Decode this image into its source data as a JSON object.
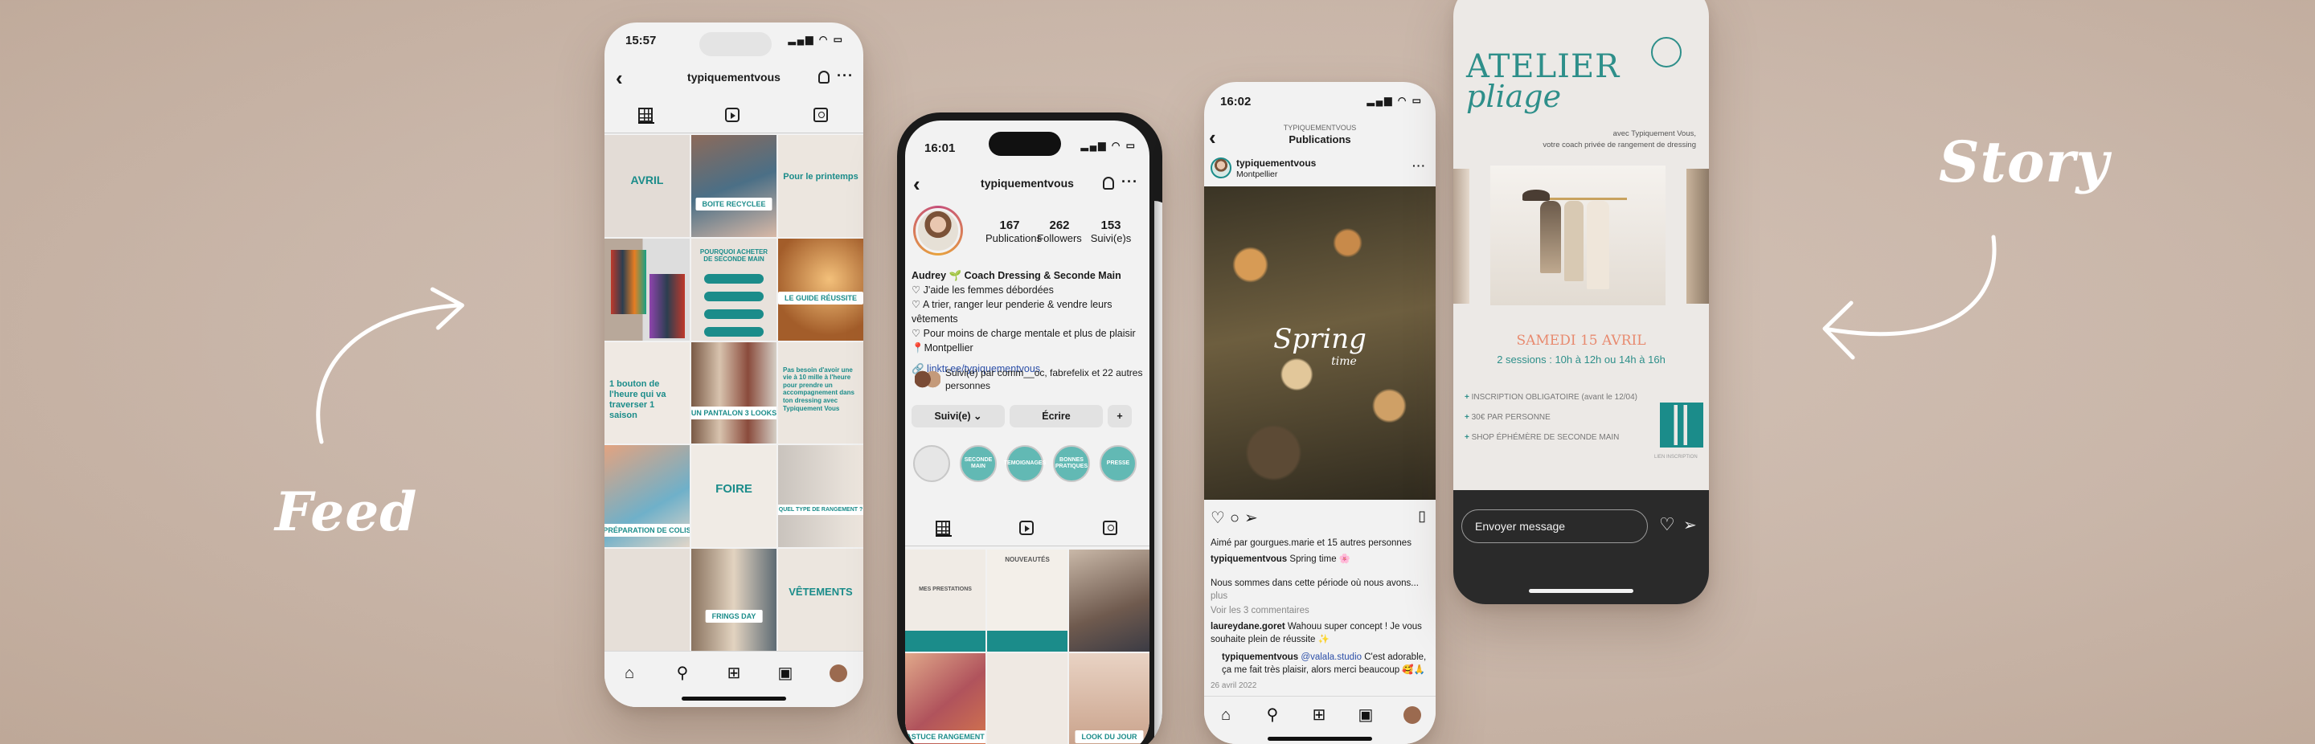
{
  "labels": {
    "feed": "Feed",
    "story": "Story"
  },
  "feed_phone": {
    "time": "15:57",
    "username": "typiquementvous",
    "tiles": [
      {
        "text": "AVRIL",
        "chip": ""
      },
      {
        "text": "",
        "chip": "BOITE RECYCLEE"
      },
      {
        "text": "Pour le printemps",
        "chip": ""
      },
      {
        "text": "",
        "chip": ""
      },
      {
        "text": "POURQUOI ACHETER DE SECONDE MAIN",
        "chip": ""
      },
      {
        "text": "",
        "chip": "LE GUIDE RÉUSSITE"
      },
      {
        "text": "1 bouton de l'heure qui va traverser 1 saison",
        "chip": ""
      },
      {
        "text": "",
        "chip": "UN PANTALON 3 LOOKS"
      },
      {
        "text": "Pas besoin d'avoir une vie à 10 mille à l'heure pour prendre un accompagnement dans ton dressing avec Typiquement Vous",
        "chip": ""
      },
      {
        "text": "",
        "chip": "PRÉPARATION DE COLIS"
      },
      {
        "text": "FOIRE",
        "chip": ""
      },
      {
        "text": "",
        "chip": "QUEL TYPE DE RANGEMENT ?"
      },
      {
        "text": "",
        "chip": ""
      },
      {
        "text": "",
        "chip": "FRINGS DAY"
      },
      {
        "text": "VÊTEMENTS",
        "chip": ""
      }
    ]
  },
  "profile_phone": {
    "time": "16:01",
    "username": "typiquementvous",
    "stats": [
      {
        "value": "167",
        "label": "Publications"
      },
      {
        "value": "262",
        "label": "Followers"
      },
      {
        "value": "153",
        "label": "Suivi(e)s"
      }
    ],
    "bio_name": "Audrey 🌱 Coach Dressing & Seconde Main",
    "bio_lines": [
      "♡ J'aide les femmes débordées",
      "♡ A trier, ranger leur penderie & vendre leurs vêtements",
      "♡ Pour moins de charge mentale et plus de plaisir",
      "📍Montpellier"
    ],
    "link": "🔗 linktr.ee/typiquementvous",
    "followed_by": "Suivi(e) par comm__oc, fabrefelix et 22 autres personnes",
    "buttons": {
      "following": "Suivi(e) ⌄",
      "message": "Écrire",
      "add": "+"
    },
    "highlights": [
      "",
      "SECONDE MAIN",
      "TEMOIGNAGES",
      "BONNES PRATIQUES",
      "PRESSE"
    ],
    "post_labels": [
      "MES PRESTATIONS",
      "NOUVEAUTÉS",
      "ASTUCE RANGEMENT",
      "LOOK DU JOUR"
    ]
  },
  "post_phone": {
    "time": "16:02",
    "header_sub": "TYPIQUEMENTVOUS",
    "header_title": "Publications",
    "username": "typiquementvous",
    "location": "Montpellier",
    "image_text": "Spring",
    "image_subtext": "time",
    "liked_by": "Aimé par gourgues.marie et 15 autres personnes",
    "caption_user": "typiquementvous",
    "caption": "Spring time 🌸",
    "caption_2": "Nous sommes dans cette période où nous avons...",
    "caption_more": "plus",
    "view_comments": "Voir les 3 commentaires",
    "comment1_user": "laureydane.goret",
    "comment1": "Wahouu super concept ! Je vous souhaite plein de réussite ✨",
    "comment2_user": "typiquementvous",
    "comment2_mention": "@valala.studio",
    "comment2": "C'est adorable, ça me fait très plaisir, alors merci beaucoup 🥰🙏",
    "date": "26 avril 2022"
  },
  "story_phone": {
    "title_line1": "ATELIER",
    "title_line2": "pliage",
    "byline1": "avec Typiquement Vous,",
    "byline2": "votre coach privée de rangement de dressing",
    "date": "SAMEDI 15 AVRIL",
    "sessions": "2 sessions : 10h à 12h ou 14h à 16h",
    "items": [
      "INSCRIPTION OBLIGATOIRE (avant le 12/04)",
      "30€ PAR PERSONNE",
      "SHOP ÉPHÉMÈRE DE SECONDE MAIN"
    ],
    "qr_caption": "LIEN INSCRIPTION",
    "message_placeholder": "Envoyer message"
  },
  "colors": {
    "background": "#c9b6a9",
    "teal": "#1b8c8a",
    "coral": "#e88a6f",
    "white": "#ffffff"
  }
}
